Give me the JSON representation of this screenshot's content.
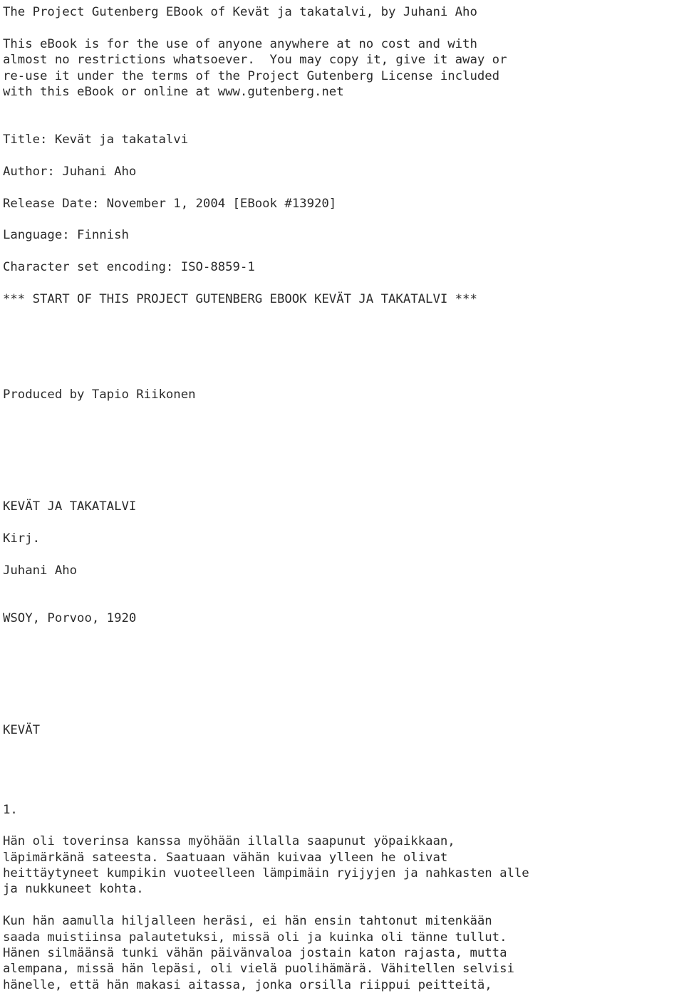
{
  "document": {
    "kind": "plain-text-ebook",
    "background_color": "#ffffff",
    "text_color": "#2b2b2b",
    "header": {
      "title_line": "The Project Gutenberg EBook of Kevät ja takatalvi, by Juhani Aho",
      "license_lines": [
        "This eBook is for the use of anyone anywhere at no cost and with",
        "almost no restrictions whatsoever.  You may copy it, give it away or",
        "re-use it under the terms of the Project Gutenberg License included",
        "with this eBook or online at www.gutenberg.net"
      ]
    },
    "metadata": {
      "title": "Title: Kevät ja takatalvi",
      "author": "Author: Juhani Aho",
      "release_date": "Release Date: November 1, 2004 [EBook #13920]",
      "language": "Language: Finnish",
      "encoding": "Character set encoding: ISO-8859-1"
    },
    "start_marker": "*** START OF THIS PROJECT GUTENBERG EBOOK KEVÄT JA TAKATALVI ***",
    "producer": "Produced by Tapio Riikonen",
    "title_page": {
      "book_title": "KEVÄT JA TAKATALVI",
      "by_label": "Kirj.",
      "author": "Juhani Aho",
      "publisher": "WSOY, Porvoo, 1920"
    },
    "part_heading": "KEVÄT",
    "chapter_number": "1.",
    "body_paragraphs": [
      [
        "Hän oli toverinsa kanssa myöhään illalla saapunut yöpaikkaan,",
        "läpimärkänä sateesta. Saatuaan vähän kuivaa ylleen he olivat",
        "heittäytyneet kumpikin vuoteelleen lämpimäin ryijyjen ja nahkasten alle",
        "ja nukkuneet kohta."
      ],
      [
        "Kun hän aamulla hiljalleen heräsi, ei hän ensin tahtonut mitenkään",
        "saada muistiinsa palautetuksi, missä oli ja kuinka oli tänne tullut.",
        "Hänen silmäänsä tunki vähän päivänvaloa jostain katon rajasta, mutta",
        "alempana, missä hän lepäsi, oli vielä puolihämärä. Vähitellen selvisi",
        "hänelle, että hän makasi aitassa, jonka orsilla riippui peitteitä,"
      ]
    ]
  }
}
